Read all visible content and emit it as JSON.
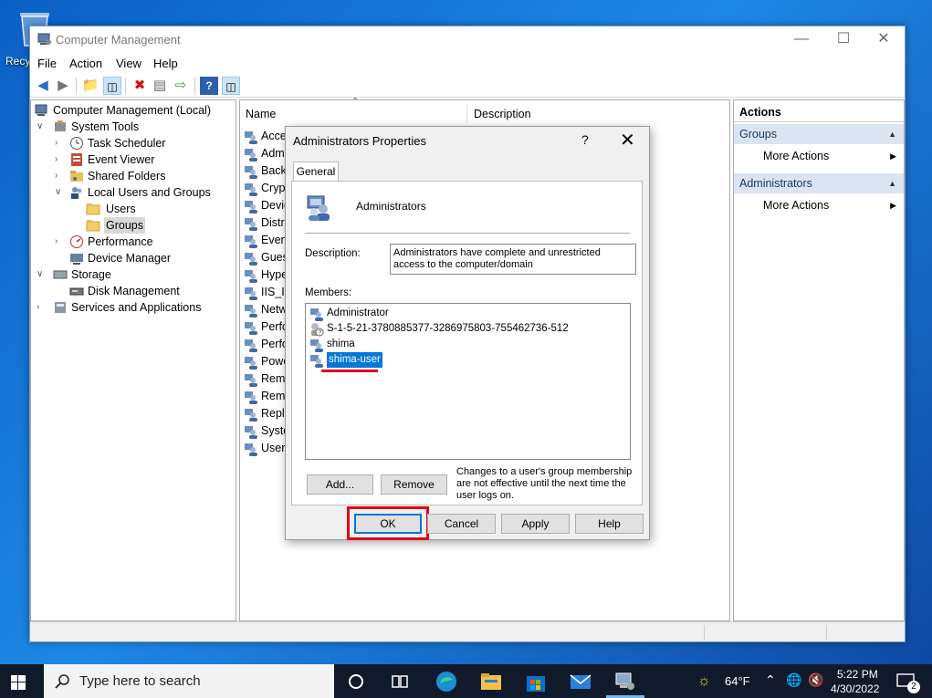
{
  "desktop": {
    "recycle_label": "Recy"
  },
  "window": {
    "title": "Computer Management",
    "menu": [
      "File",
      "Action",
      "View",
      "Help"
    ]
  },
  "tree": {
    "root": "Computer Management (Local)",
    "system_tools": "System Tools",
    "task_scheduler": "Task Scheduler",
    "event_viewer": "Event Viewer",
    "shared_folders": "Shared Folders",
    "local_users_groups": "Local Users and Groups",
    "users": "Users",
    "groups": "Groups",
    "performance": "Performance",
    "device_manager": "Device Manager",
    "storage": "Storage",
    "disk_management": "Disk Management",
    "services_apps": "Services and Applications"
  },
  "list": {
    "col_name": "Name",
    "col_desc": "Description",
    "rows": [
      "Acces",
      "Admi",
      "Backu",
      "Crypt",
      "Devic",
      "Distri",
      "Event",
      "Guest",
      "Hype",
      "IIS_IU",
      "Netw",
      "Perfo",
      "Perfo",
      "Powe",
      "Remo",
      "Remo",
      "Repli",
      "Syste",
      "Users"
    ]
  },
  "actions": {
    "header": "Actions",
    "section1": "Groups",
    "section1_more": "More Actions",
    "section2": "Administrators",
    "section2_more": "More Actions"
  },
  "dialog": {
    "title": "Administrators Properties",
    "help_glyph": "?",
    "close_glyph": "✕",
    "tab": "General",
    "group_name": "Administrators",
    "description_label": "Description:",
    "description_value": "Administrators have complete and unrestricted access to the computer/domain",
    "members_label": "Members:",
    "members": [
      "Administrator",
      "S-1-5-21-3780885377-3286975803-755462736-512",
      "shima",
      "shima-user"
    ],
    "selected_member": "shima-user",
    "add_button": "Add...",
    "remove_button": "Remove",
    "note": "Changes to a user's group membership are not effective until the next time the user logs on.",
    "ok": "OK",
    "cancel": "Cancel",
    "apply": "Apply",
    "help": "Help"
  },
  "taskbar": {
    "search_placeholder": "Type here to search",
    "weather": "64°F",
    "time": "5:22 PM",
    "date": "4/30/2022",
    "notifications": "2"
  },
  "colors": {
    "selection": "#0078d7",
    "highlight_box": "#e00016",
    "actions_section_bg": "#dbe5f1"
  }
}
